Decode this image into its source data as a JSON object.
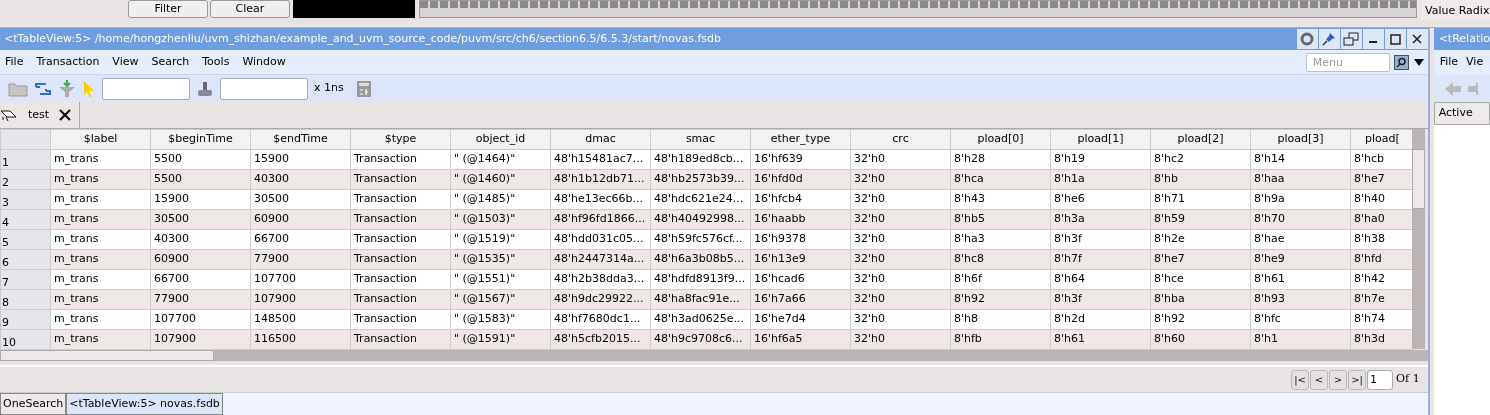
{
  "top_strip": {
    "buttons": [
      "Filter",
      "Clear"
    ],
    "value_radix": "Value Radix"
  },
  "window": {
    "title": "<tTableView:5> /home/hongzhenliu/uvm_shizhan/example_and_uvm_source_code/puvm/src/ch6/section6.5/6.5.3/start/novas.fsdb"
  },
  "menu": [
    "File",
    "Transaction",
    "View",
    "Search",
    "Tools",
    "Window"
  ],
  "menu_search": {
    "placeholder": "Menu"
  },
  "toolbar": {
    "unit": "x 1ns"
  },
  "tabs": [
    {
      "label": "test",
      "selected": true
    }
  ],
  "table": {
    "columns": [
      "$label",
      "$beginTime",
      "$endTime",
      "$type",
      "object_id",
      "dmac",
      "smac",
      "ether_type",
      "crc",
      "pload[0]",
      "pload[1]",
      "pload[2]",
      "pload[3]",
      "pload["
    ],
    "rows": [
      {
        "index": "1",
        "cells": [
          "m_trans",
          "5500",
          "15900",
          "Transaction",
          "\" (@1464)\"",
          "48'h15481ac7...",
          "48'h189ed8cb...",
          "16'hf639",
          "32'h0",
          "8'h28",
          "8'h19",
          "8'hc2",
          "8'h14",
          "8'hcb"
        ]
      },
      {
        "index": "2",
        "cells": [
          "m_trans",
          "5500",
          "40300",
          "Transaction",
          "\" (@1460)\"",
          "48'h1b12db71...",
          "48'hb2573b39...",
          "16'hfd0d",
          "32'h0",
          "8'hca",
          "8'h1a",
          "8'hb",
          "8'haa",
          "8'he7"
        ]
      },
      {
        "index": "3",
        "cells": [
          "m_trans",
          "15900",
          "30500",
          "Transaction",
          "\" (@1485)\"",
          "48'he13ec66b...",
          "48'hdc621e24...",
          "16'hfcb4",
          "32'h0",
          "8'h43",
          "8'he6",
          "8'h71",
          "8'h9a",
          "8'h40"
        ]
      },
      {
        "index": "4",
        "cells": [
          "m_trans",
          "30500",
          "60900",
          "Transaction",
          "\" (@1503)\"",
          "48'hf96fd1866...",
          "48'h40492998...",
          "16'haabb",
          "32'h0",
          "8'hb5",
          "8'h3a",
          "8'h59",
          "8'h70",
          "8'ha0"
        ]
      },
      {
        "index": "5",
        "cells": [
          "m_trans",
          "40300",
          "66700",
          "Transaction",
          "\" (@1519)\"",
          "48'hdd031c05...",
          "48'h59fc576cf...",
          "16'h9378",
          "32'h0",
          "8'ha3",
          "8'h3f",
          "8'h2e",
          "8'hae",
          "8'h38"
        ]
      },
      {
        "index": "6",
        "cells": [
          "m_trans",
          "60900",
          "77900",
          "Transaction",
          "\" (@1535)\"",
          "48'h2447314a...",
          "48'h6a3b08b5...",
          "16'h13e9",
          "32'h0",
          "8'hc8",
          "8'h7f",
          "8'he7",
          "8'he9",
          "8'hfd"
        ]
      },
      {
        "index": "7",
        "cells": [
          "m_trans",
          "66700",
          "107700",
          "Transaction",
          "\" (@1551)\"",
          "48'h2b38dda3...",
          "48'hdfd8913f9...",
          "16'hcad6",
          "32'h0",
          "8'h6f",
          "8'h64",
          "8'hce",
          "8'h61",
          "8'h42"
        ]
      },
      {
        "index": "8",
        "cells": [
          "m_trans",
          "77900",
          "107900",
          "Transaction",
          "\" (@1567)\"",
          "48'h9dc29922...",
          "48'ha8fac91e...",
          "16'h7a66",
          "32'h0",
          "8'h92",
          "8'h3f",
          "8'hba",
          "8'h93",
          "8'h7e"
        ]
      },
      {
        "index": "9",
        "cells": [
          "m_trans",
          "107700",
          "148500",
          "Transaction",
          "\" (@1583)\"",
          "48'hf7680dc1...",
          "48'h3ad0625e...",
          "16'he7d4",
          "32'h0",
          "8'h8",
          "8'h2d",
          "8'h92",
          "8'hfc",
          "8'h74"
        ]
      },
      {
        "index": "10",
        "cells": [
          "m_trans",
          "107900",
          "116500",
          "Transaction",
          "\" (@1591)\"",
          "48'h5cfb2015...",
          "48'h9c9708c6...",
          "16'hf6a5",
          "32'h0",
          "8'hfb",
          "8'h61",
          "8'h60",
          "8'h1",
          "8'h3d"
        ]
      }
    ]
  },
  "pager": {
    "buttons": [
      "|<",
      "<",
      ">",
      ">|"
    ],
    "page": "1",
    "total": "Of 1"
  },
  "bottom_tabs": [
    {
      "label": "OneSearch",
      "selected": false
    },
    {
      "label": "<tTableView:5> novas.fsdb",
      "selected": true
    }
  ],
  "side_panel": {
    "title": "<tRelatio",
    "menu": [
      "File",
      "Vie"
    ],
    "column": "Active"
  }
}
